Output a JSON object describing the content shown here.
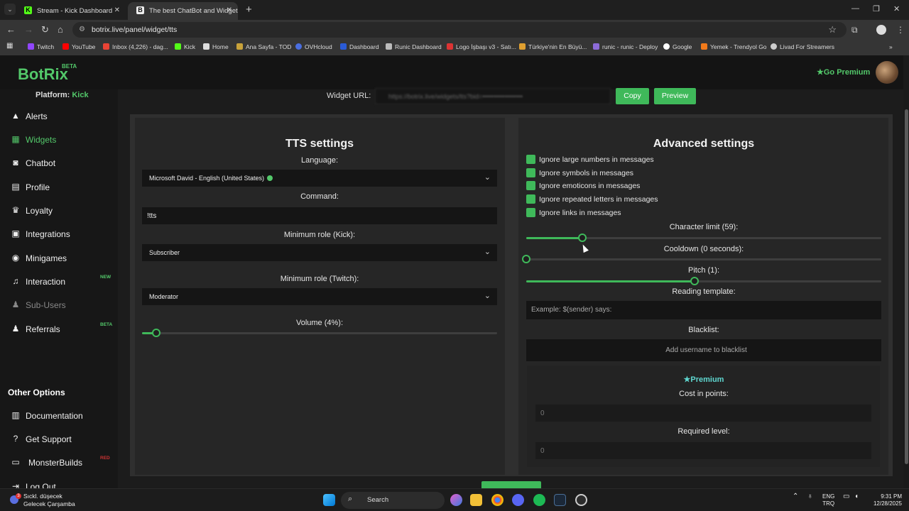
{
  "browser": {
    "tabs": [
      {
        "title": "Stream - Kick Dashboard",
        "active": false
      },
      {
        "title": "The best ChatBot and Widgets",
        "active": true
      }
    ],
    "url": "botrix.live/panel/widget/tts",
    "bookmarks": [
      "Twitch",
      "YouTube",
      "Inbox (4,226) - dag...",
      "Kick",
      "Home",
      "Ana Sayfa - TOD",
      "OVHcloud",
      "Dashboard",
      "Runic Dashboard",
      "Logo İşbaşı v3 - Satı...",
      "Türkiye'nin En Büyü...",
      "runic - runic - Deploy",
      "Google",
      "Yemek - Trendyol Go",
      "Livad For Streamers"
    ]
  },
  "header": {
    "logo": "BotRix",
    "logo_badge": "BETA",
    "premium_link": "Go Premium"
  },
  "sidebar": {
    "platform_label": "Platform:",
    "platform_value": "Kick",
    "items": [
      {
        "label": "Alerts",
        "icon": "warning-icon"
      },
      {
        "label": "Widgets",
        "icon": "grid-icon",
        "active": true
      },
      {
        "label": "Chatbot",
        "icon": "robot-icon"
      },
      {
        "label": "Profile",
        "icon": "id-card-icon"
      },
      {
        "label": "Loyalty",
        "icon": "trophy-icon"
      },
      {
        "label": "Integrations",
        "icon": "plug-icon"
      },
      {
        "label": "Minigames",
        "icon": "gamepad-icon"
      },
      {
        "label": "Interaction",
        "icon": "music-icon",
        "badge": "NEW"
      },
      {
        "label": "Sub-Users",
        "icon": "users-icon",
        "muted": true
      },
      {
        "label": "Referrals",
        "icon": "users-icon",
        "badge": "BETA"
      }
    ],
    "other_options_title": "Other Options",
    "other_items": [
      {
        "label": "Documentation",
        "icon": "book-icon"
      },
      {
        "label": "Get Support",
        "icon": "question-icon"
      },
      {
        "label": "MonsterBuilds",
        "icon": "laptop-icon",
        "badge": "RED"
      },
      {
        "label": "Log Out",
        "icon": "logout-icon"
      }
    ]
  },
  "widget_url": {
    "label": "Widget URL:",
    "value": "https://botrix.live/widgets/tts?bid=••••••••••••••••••",
    "copy_label": "Copy",
    "preview_label": "Preview"
  },
  "tts": {
    "title": "TTS settings",
    "language_label": "Language:",
    "language_value": "Microsoft David - English (United States)",
    "command_label": "Command:",
    "command_value": "!tts",
    "min_role_kick_label": "Minimum role (Kick):",
    "min_role_kick_value": "Subscriber",
    "min_role_twitch_label": "Minimum role (Twitch):",
    "min_role_twitch_value": "Moderator",
    "volume_label": "Volume (4%):",
    "volume_fraction": 0.04
  },
  "advanced": {
    "title": "Advanced settings",
    "checkboxes": [
      {
        "label": "Ignore large numbers in messages",
        "checked": true
      },
      {
        "label": "Ignore symbols in messages",
        "checked": true
      },
      {
        "label": "Ignore emoticons in messages",
        "checked": true
      },
      {
        "label": "Ignore repeated letters in messages",
        "checked": true
      },
      {
        "label": "Ignore links in messages",
        "checked": true
      }
    ],
    "char_limit_label": "Character limit (59):",
    "char_limit_fraction": 0.157,
    "cooldown_label": "Cooldown (0 seconds):",
    "cooldown_fraction": 0.0,
    "pitch_label": "Pitch (1):",
    "pitch_fraction": 0.474,
    "reading_template_label": "Reading template:",
    "reading_template_placeholder": "Example: $(sender) says:",
    "blacklist_label": "Blacklist:",
    "blacklist_placeholder": "Add username to blacklist",
    "premium_title": "Premium",
    "cost_label": "Cost in points:",
    "cost_value": "0",
    "level_label": "Required level:",
    "level_value": "0"
  },
  "taskbar": {
    "weather_line1": "Sıckl. düşecek",
    "weather_line2": "Gelecek Çarşamba",
    "weather_badge": "3",
    "search_label": "Search",
    "lang_line1": "ENG",
    "lang_line2": "TRQ",
    "time": "9:31 PM",
    "date": "12/28/2025"
  },
  "colors": {
    "accent": "#3fb95a",
    "accent_text": "#53c86a",
    "panel": "#262626",
    "input": "#151515"
  }
}
